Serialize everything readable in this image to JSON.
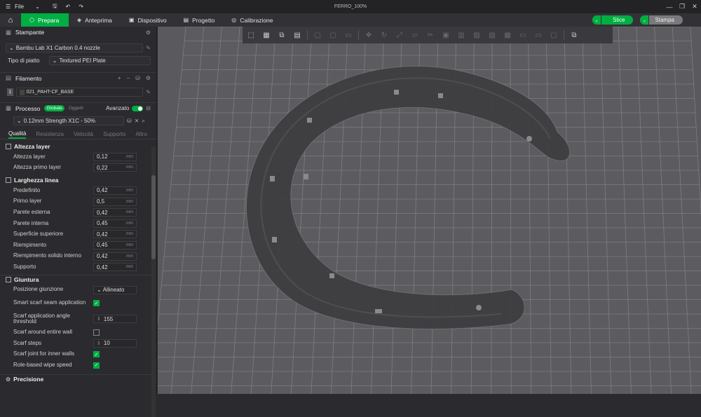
{
  "window": {
    "menu_label": "File",
    "title": "FERRO_100%"
  },
  "tabs": [
    {
      "label": "Prepara",
      "icon": "cube-icon"
    },
    {
      "label": "Anteprima",
      "icon": "layers-icon"
    },
    {
      "label": "Dispositivo",
      "icon": "device-icon"
    },
    {
      "label": "Progetto",
      "icon": "project-icon"
    },
    {
      "label": "Calibrazione",
      "icon": "calibration-icon"
    }
  ],
  "actions": {
    "slice_label": "Slice",
    "print_label": "Stampa"
  },
  "printer": {
    "section_label": "Stampante",
    "printer_value": "Bambu Lab X1 Carbon 0.4 nozzle",
    "plate_label": "Tipo di piatto",
    "plate_value": "Textured PEI Plate"
  },
  "filament": {
    "section_label": "Filamento",
    "slot_number": "1",
    "name": "021_PAHT-CF_BASE",
    "add_symbol": "+",
    "remove_symbol": "−"
  },
  "process": {
    "section_label": "Processo",
    "badge_global": "Globale",
    "badge_object": "Oggetti",
    "advanced_label": "Avanzato",
    "advanced_on": true,
    "preset_value": "0.12mm Strength X1C - 50%",
    "subtabs": [
      "Qualità",
      "Resistenza",
      "Velocità",
      "Supporto",
      "Altro"
    ]
  },
  "groups": {
    "layer_height": {
      "title": "Altezza layer",
      "rows": [
        {
          "label": "Altezza layer",
          "value": "0,12",
          "unit": "mm"
        },
        {
          "label": "Altezza primo layer",
          "value": "0,22",
          "unit": "mm"
        }
      ]
    },
    "line_width": {
      "title": "Larghezza linea",
      "rows": [
        {
          "label": "Predefinito",
          "value": "0,42",
          "unit": "mm"
        },
        {
          "label": "Primo layer",
          "value": "0,5",
          "unit": "mm"
        },
        {
          "label": "Parete esterna",
          "value": "0,42",
          "unit": "mm"
        },
        {
          "label": "Parete interna",
          "value": "0,45",
          "unit": "mm"
        },
        {
          "label": "Superficie superiore",
          "value": "0,42",
          "unit": "mm"
        },
        {
          "label": "Riempimento",
          "value": "0,45",
          "unit": "mm"
        },
        {
          "label": "Riempimento solido interno",
          "value": "0,42",
          "unit": "mm"
        },
        {
          "label": "Supporto",
          "value": "0,42",
          "unit": "mm"
        }
      ]
    },
    "seam": {
      "title": "Giuntura",
      "position_label": "Posizione giunzione",
      "position_value": "Allineato",
      "smart_scarf_label": "Smart scarf seam application",
      "smart_scarf_checked": true,
      "angle_label": "Scarf application angle threshold",
      "angle_value": "155",
      "around_label": "Scarf around entire wall",
      "around_checked": false,
      "steps_label": "Scarf steps",
      "steps_value": "10",
      "inner_label": "Scarf joint for inner walls",
      "inner_checked": true,
      "wipe_label": "Role-based wipe speed",
      "wipe_checked": true
    },
    "precision": {
      "title": "Precisione"
    }
  },
  "colors": {
    "accent": "#00ae42",
    "background": "#2b2b2f",
    "viewport": "#5a5a5e",
    "model": "#3c3c3e"
  }
}
